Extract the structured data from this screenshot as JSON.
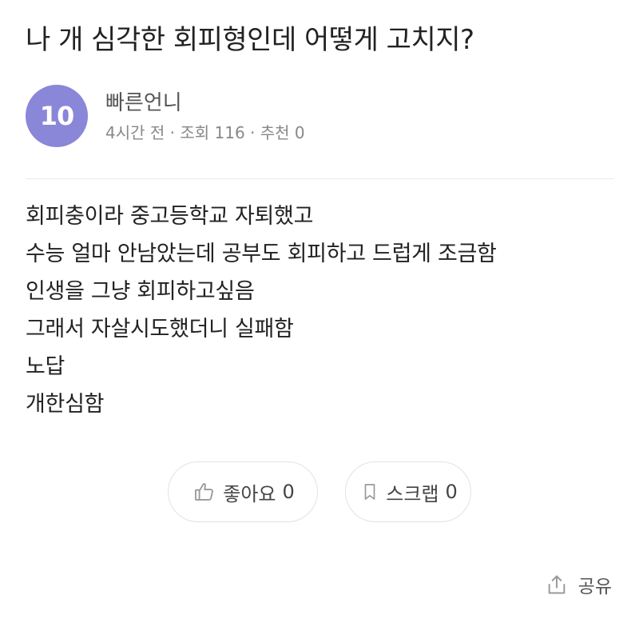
{
  "post": {
    "title": "나 개 심각한 회피형인데 어떻게 고치지?",
    "author": {
      "level": "10",
      "name": "빠른언니",
      "avatar_color": "#8a86d8"
    },
    "meta": "4시간 전 · 조회 116 · 추천 0",
    "body_lines": [
      "회피충이라 중고등학교 자퇴했고",
      "수능 얼마 안남았는데 공부도 회피하고 드럽게 조금함",
      "인생을 그냥 회피하고싶음",
      "그래서 자살시도했더니 실패함",
      "노답",
      "개한심함"
    ]
  },
  "actions": {
    "like": {
      "label": "좋아요",
      "count": "0",
      "icon": "thumbs-up-icon"
    },
    "scrap": {
      "label": "스크랩",
      "count": "0",
      "icon": "bookmark-icon"
    },
    "share": {
      "label": "공유",
      "icon": "share-icon"
    }
  }
}
